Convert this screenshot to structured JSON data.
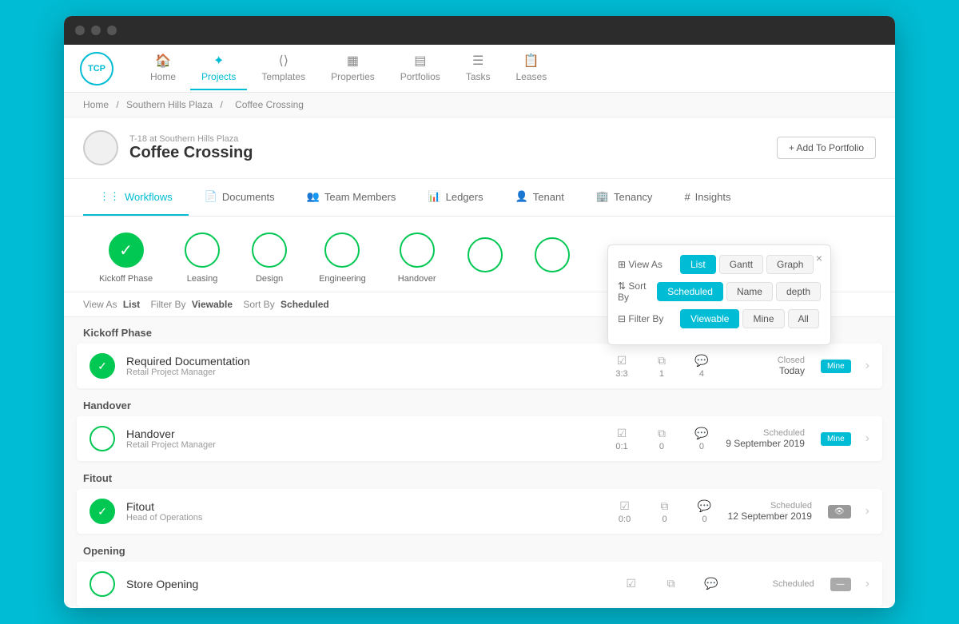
{
  "browser": {
    "dots": [
      "dot1",
      "dot2",
      "dot3"
    ]
  },
  "nav": {
    "logo": "TCP",
    "items": [
      {
        "label": "Home",
        "icon": "🏠",
        "active": false
      },
      {
        "label": "Projects",
        "icon": "✦",
        "active": true
      },
      {
        "label": "Templates",
        "icon": "⟨/⟩",
        "active": false
      },
      {
        "label": "Properties",
        "icon": "▦",
        "active": false
      },
      {
        "label": "Portfolios",
        "icon": "▤",
        "active": false
      },
      {
        "label": "Tasks",
        "icon": "☰",
        "active": false
      },
      {
        "label": "Leases",
        "icon": "📋",
        "active": false
      }
    ]
  },
  "breadcrumb": {
    "items": [
      "Home",
      "Southern Hills Plaza",
      "Coffee Crossing"
    ],
    "separators": [
      "/",
      "/"
    ]
  },
  "project": {
    "subtitle": "T-18 at Southern Hills Plaza",
    "title": "Coffee Crossing",
    "add_portfolio_label": "+ Add To Portfolio"
  },
  "sub_nav": {
    "items": [
      {
        "label": "Workflows",
        "icon": "⋮⋮",
        "active": true
      },
      {
        "label": "Documents",
        "icon": "📄",
        "active": false
      },
      {
        "label": "Team Members",
        "icon": "👥",
        "active": false
      },
      {
        "label": "Ledgers",
        "icon": "📊",
        "active": false
      },
      {
        "label": "Tenant",
        "icon": "👤",
        "active": false
      },
      {
        "label": "Tenancy",
        "icon": "🏢",
        "active": false
      },
      {
        "label": "Insights",
        "icon": "#",
        "active": false
      }
    ]
  },
  "workflow_circles": [
    {
      "label": "Kickoff Phase",
      "completed": true
    },
    {
      "label": "Leasing",
      "completed": false
    },
    {
      "label": "Design",
      "completed": false
    },
    {
      "label": "Engineering",
      "completed": false
    },
    {
      "label": "Handover",
      "completed": false
    },
    {
      "label": "",
      "completed": false
    },
    {
      "label": "",
      "completed": false
    }
  ],
  "filter_bar": {
    "view_as_label": "View As",
    "view_as_value": "List",
    "filter_by_label": "Filter By",
    "filter_by_value": "Viewable",
    "sort_by_label": "Sort By",
    "sort_by_value": "Scheduled"
  },
  "view_popup": {
    "view_as_label": "⊞ View As",
    "sort_by_label": "⇅ Sort By",
    "filter_by_label": "⊟ Filter By",
    "close_label": "×",
    "view_options": [
      {
        "label": "List",
        "active": true
      },
      {
        "label": "Gantt",
        "active": false
      },
      {
        "label": "Graph",
        "active": false
      }
    ],
    "sort_options": [
      {
        "label": "Scheduled",
        "active": true
      },
      {
        "label": "Name",
        "active": false
      },
      {
        "label": "depth",
        "active": false
      }
    ],
    "filter_options": [
      {
        "label": "Viewable",
        "active": true
      },
      {
        "label": "Mine",
        "active": false
      },
      {
        "label": "All",
        "active": false
      }
    ]
  },
  "phases": [
    {
      "name": "Kickoff Phase",
      "tasks": [
        {
          "name": "Required Documentation",
          "sub": "Retail Project Manager",
          "completed": true,
          "check_count": "3:3",
          "copy_count": "1",
          "comment_count": "4",
          "status": "Closed",
          "date": "Today",
          "badge": "mine"
        }
      ]
    },
    {
      "name": "Handover",
      "tasks": [
        {
          "name": "Handover",
          "sub": "Retail Project Manager",
          "completed": false,
          "check_count": "0:1",
          "copy_count": "0",
          "comment_count": "0",
          "status": "Scheduled",
          "date": "9 September 2019",
          "badge": "mine"
        }
      ]
    },
    {
      "name": "Fitout",
      "tasks": [
        {
          "name": "Fitout",
          "sub": "Head of Operations",
          "completed": true,
          "check_count": "0:0",
          "copy_count": "0",
          "comment_count": "0",
          "status": "Scheduled",
          "date": "12 September 2019",
          "badge": "eye"
        }
      ]
    },
    {
      "name": "Opening",
      "tasks": [
        {
          "name": "Store Opening",
          "sub": "",
          "completed": false,
          "check_count": "",
          "copy_count": "",
          "comment_count": "",
          "status": "Scheduled",
          "date": "",
          "badge": "dash"
        }
      ]
    }
  ]
}
